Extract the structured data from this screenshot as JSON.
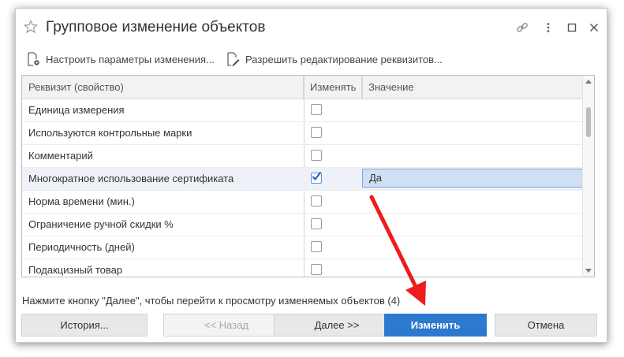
{
  "window": {
    "title": "Групповое изменение объектов"
  },
  "toolbar": {
    "configure_label": "Настроить параметры изменения...",
    "allow_edit_label": "Разрешить редактирование реквизитов..."
  },
  "grid": {
    "columns": [
      "Реквизит (свойство)",
      "Изменять",
      "Значение"
    ],
    "rows": [
      {
        "name": "Единица измерения",
        "checked": false,
        "value": ""
      },
      {
        "name": "Используются контрольные марки",
        "checked": false,
        "value": ""
      },
      {
        "name": "Комментарий",
        "checked": false,
        "value": ""
      },
      {
        "name": "Многократное использование сертификата",
        "checked": true,
        "value": "Да"
      },
      {
        "name": "Норма времени (мин.)",
        "checked": false,
        "value": ""
      },
      {
        "name": "Ограничение ручной скидки %",
        "checked": false,
        "value": ""
      },
      {
        "name": "Периодичность (дней)",
        "checked": false,
        "value": ""
      },
      {
        "name": "Подакцизный товар",
        "checked": false,
        "value": ""
      }
    ]
  },
  "hint": "Нажмите кнопку \"Далее\", чтобы перейти к просмотру изменяемых объектов (4)",
  "buttons": {
    "history": "История...",
    "back": "<<   Назад",
    "next": "Далее    >>",
    "apply": "Изменить",
    "cancel": "Отмена"
  },
  "colors": {
    "accent": "#2c79d0",
    "annotation_arrow": "#ee1c1c",
    "selected_value_bg": "#cfe0f5"
  }
}
